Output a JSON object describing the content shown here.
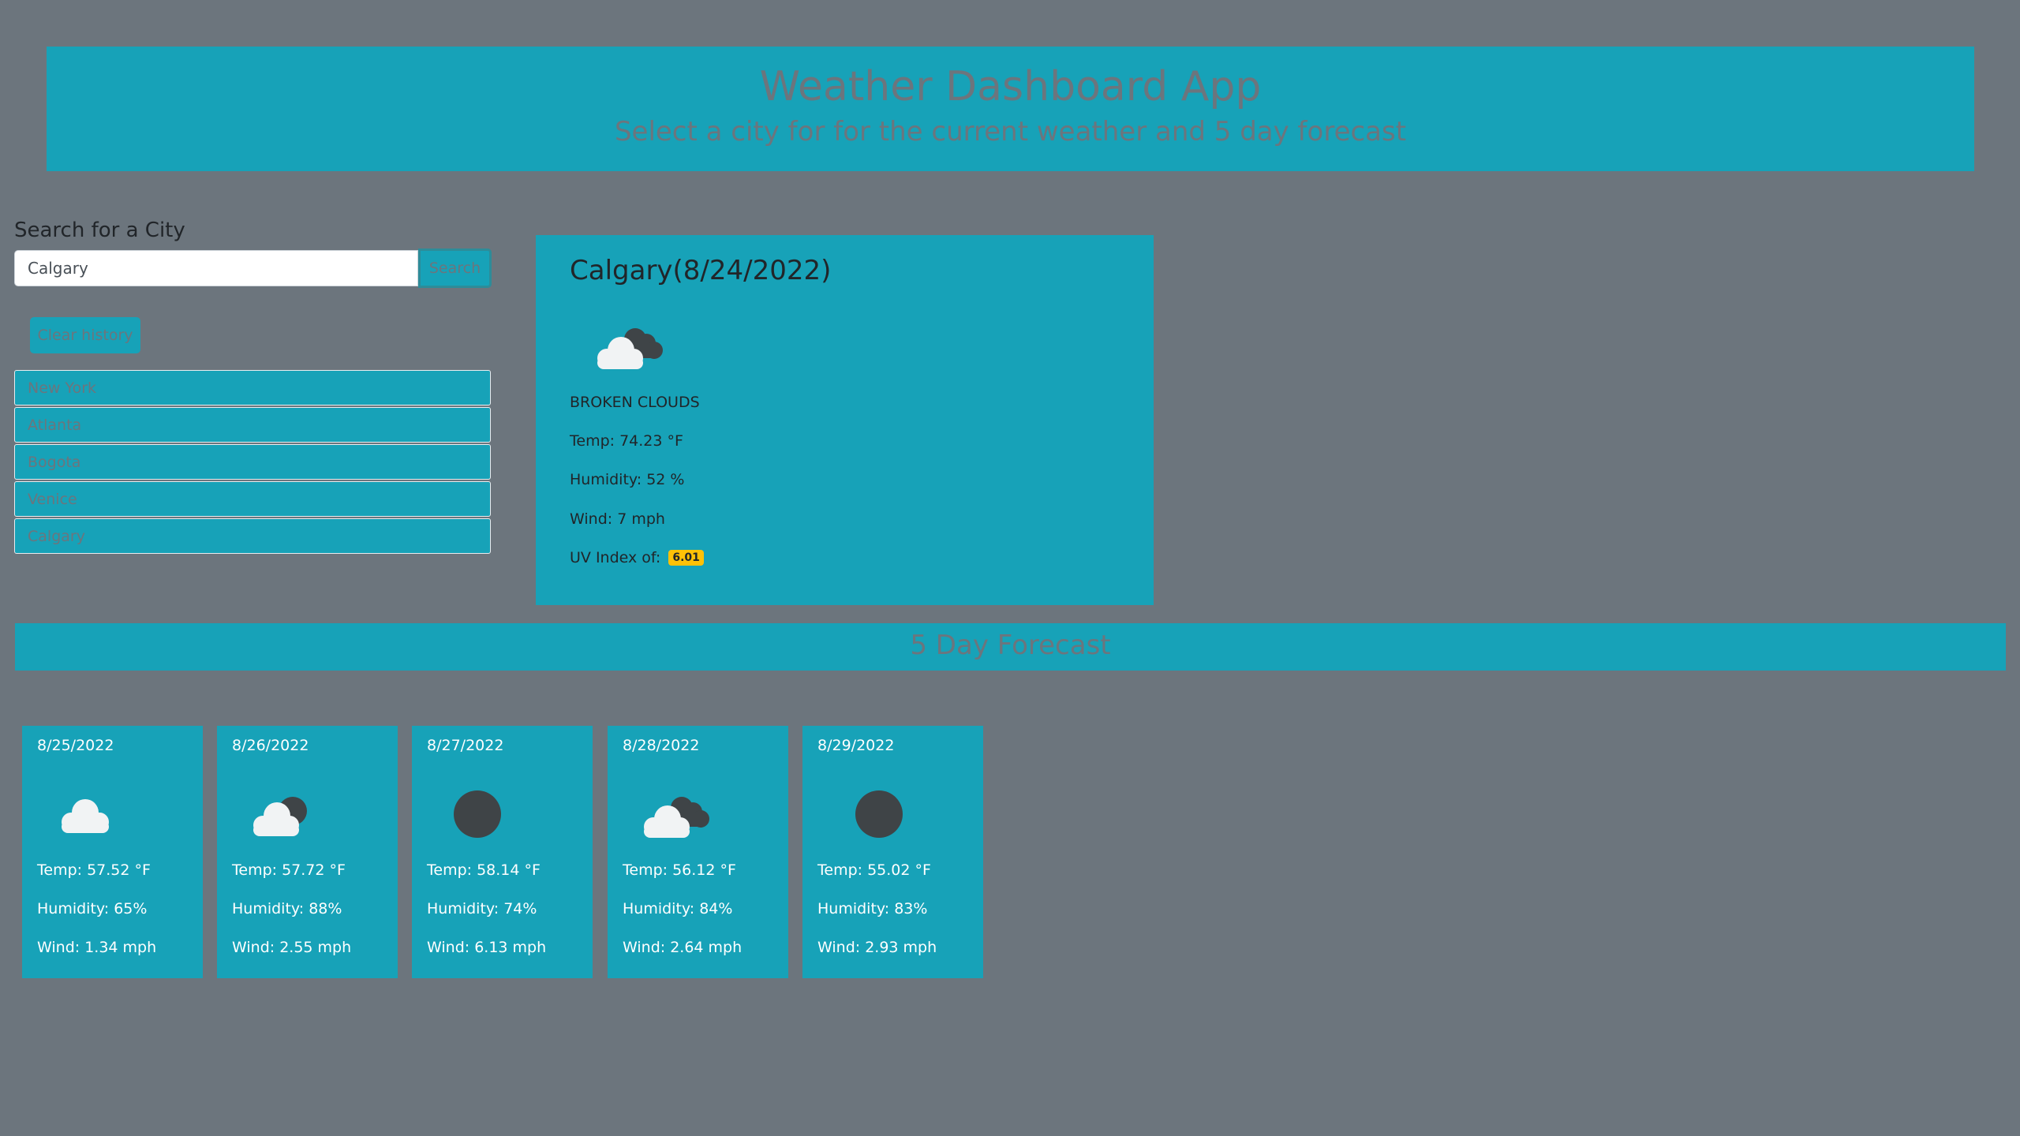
{
  "header": {
    "title": "Weather Dashboard App",
    "subtitle": "Select a city for for the current weather and 5 day forecast"
  },
  "search": {
    "label": "Search for a City",
    "value": "Calgary",
    "placeholder": "",
    "button_label": "Search",
    "clear_label": "Clear history"
  },
  "history": [
    "New York",
    "Atlanta",
    "Bogota",
    "Venice",
    "Calgary"
  ],
  "current": {
    "title": "Calgary(8/24/2022)",
    "icon": "broken-clouds-icon",
    "description": "BROKEN CLOUDS",
    "temp": "Temp: 74.23 °F",
    "humidity": "Humidity: 52 %",
    "wind": "Wind: 7 mph",
    "uv_label": "UV Index of:",
    "uv_value": "6.01",
    "uv_color": "#ffc107"
  },
  "forecast": {
    "title": "5 Day Forecast",
    "days": [
      {
        "date": "8/25/2022",
        "icon": "cloud-icon",
        "temp": "Temp: 57.52 °F",
        "humidity": "Humidity: 65%",
        "wind": "Wind: 1.34 mph"
      },
      {
        "date": "8/26/2022",
        "icon": "cloud-dark-icon",
        "temp": "Temp: 57.72 °F",
        "humidity": "Humidity: 88%",
        "wind": "Wind: 2.55 mph"
      },
      {
        "date": "8/27/2022",
        "icon": "overcast-icon",
        "temp": "Temp: 58.14 °F",
        "humidity": "Humidity: 74%",
        "wind": "Wind: 6.13 mph"
      },
      {
        "date": "8/28/2022",
        "icon": "broken-clouds-icon",
        "temp": "Temp: 56.12 °F",
        "humidity": "Humidity: 84%",
        "wind": "Wind: 2.64 mph"
      },
      {
        "date": "8/29/2022",
        "icon": "overcast-icon",
        "temp": "Temp: 55.02 °F",
        "humidity": "Humidity: 83%",
        "wind": "Wind: 2.93 mph"
      }
    ]
  },
  "colors": {
    "background": "#6c757d",
    "accent": "#17a2b8",
    "muted_text": "#6c757d",
    "uv_moderate": "#ffc107"
  }
}
